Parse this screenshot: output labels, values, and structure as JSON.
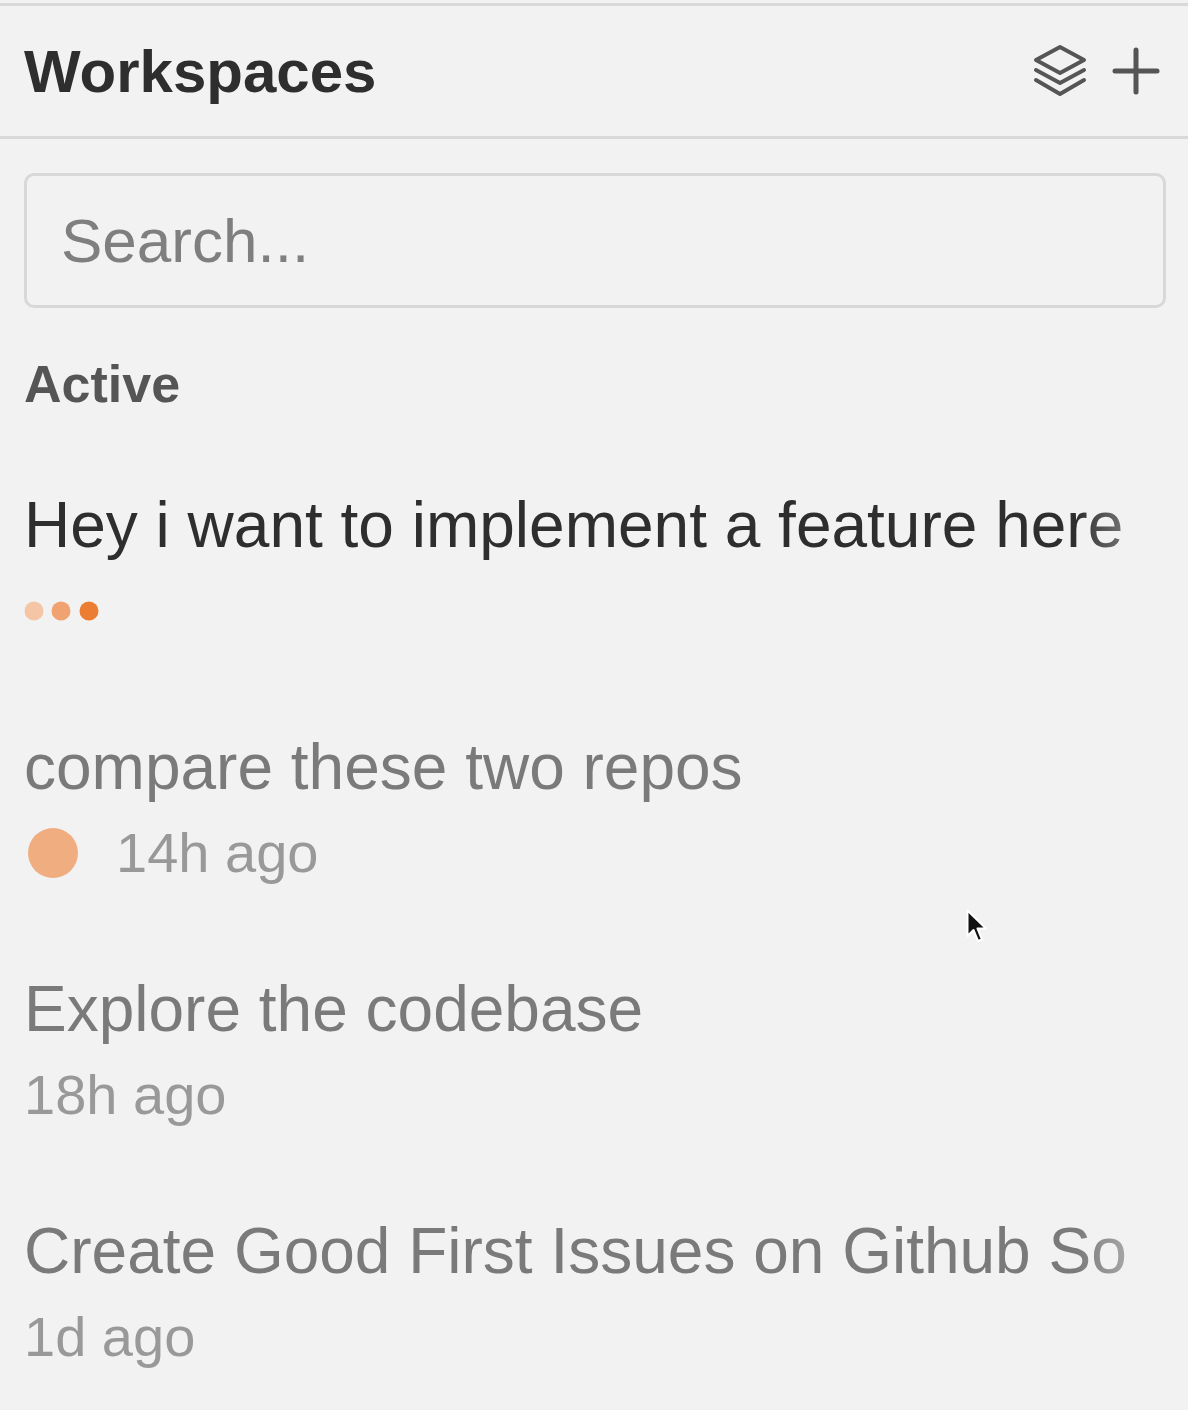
{
  "header": {
    "title": "Workspaces"
  },
  "search": {
    "placeholder": "Search..."
  },
  "section": {
    "label": "Active"
  },
  "workspaces": [
    {
      "title": "Hey i want to implement a feature here",
      "kind": "running"
    },
    {
      "title": "compare these two repos",
      "kind": "unread",
      "time": "14h ago"
    },
    {
      "title": "Explore the codebase",
      "kind": "idle",
      "time": "18h ago"
    },
    {
      "title": "Create Good First Issues on Github So",
      "kind": "idle",
      "time": "1d ago"
    }
  ]
}
